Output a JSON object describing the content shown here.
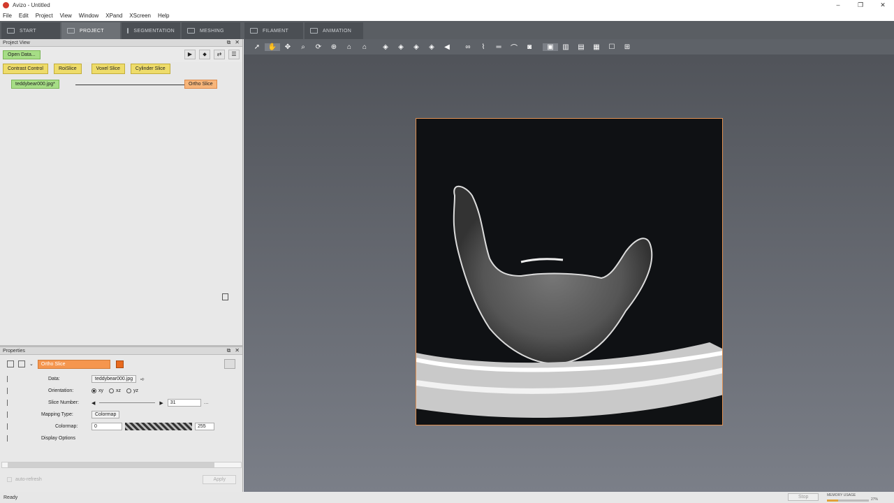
{
  "window": {
    "title": "Avizo - Untitled"
  },
  "menu": [
    "File",
    "Edit",
    "Project",
    "View",
    "Window",
    "XPand",
    "XScreen",
    "Help"
  ],
  "workroom_tabs": [
    {
      "label": "START",
      "active": false
    },
    {
      "label": "PROJECT",
      "active": true
    },
    {
      "label": "SEGMENTATION",
      "active": false
    },
    {
      "label": "MESHING",
      "active": false
    },
    {
      "label": "FILAMENT",
      "active": false
    },
    {
      "label": "ANIMATION",
      "active": false
    }
  ],
  "project_view": {
    "title": "Project View",
    "open_data": "Open Data...",
    "quick_modules": [
      "Contrast Control",
      "RoiSlice",
      "Voxel Slice",
      "Cylinder Slice"
    ],
    "nodes": {
      "data": "teddybear000.jpg*",
      "module": "Ortho Slice"
    }
  },
  "properties": {
    "title": "Properties",
    "module_name": "Ortho Slice",
    "data_label": "Data:",
    "data_value": "teddybear000.jpg",
    "orientation_label": "Orientation:",
    "orientation_options": [
      "xy",
      "xz",
      "yz"
    ],
    "slice_label": "Slice Number:",
    "slice_value": "31",
    "mapping_label": "Mapping Type:",
    "mapping_value": "Colormap",
    "colormap_label": "Colormap:",
    "colormap_min": "0",
    "colormap_max": "255",
    "display_options": "Display Options",
    "auto_refresh": "auto-refresh",
    "apply": "Apply"
  },
  "status": {
    "text": "Ready",
    "stop": "Stop",
    "memory_label": "MEMORY USAGE",
    "memory_pct": "27%",
    "memory_fraction": 0.27
  },
  "colors": {
    "accent": "#f5964e",
    "node_green": "#a6dd86",
    "quick_yellow": "#eedc6a",
    "viewer_bg": "#5e6268"
  }
}
